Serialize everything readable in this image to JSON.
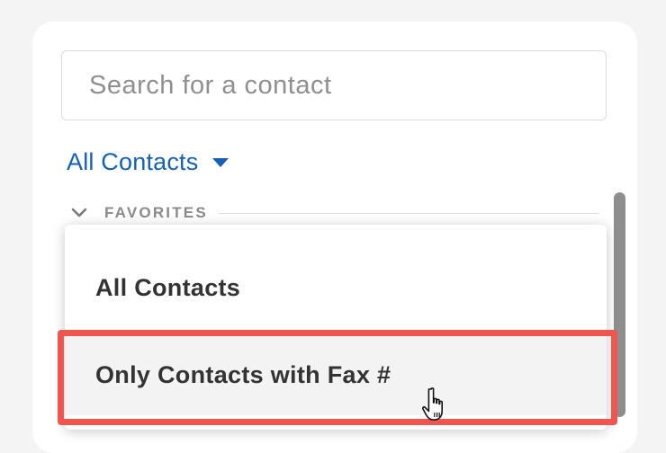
{
  "search": {
    "placeholder": "Search for a contact",
    "value": ""
  },
  "filter": {
    "selected_label": "All Contacts",
    "icon": "caret-down-icon",
    "color": "#1560b8"
  },
  "favorites": {
    "label": "FAVORITES",
    "icon": "chevron-down-icon"
  },
  "dropdown": {
    "options": [
      {
        "label": "All Contacts"
      },
      {
        "label": "Only Contacts with Fax #"
      }
    ],
    "hovered_index": 1
  },
  "annotation": {
    "highlight_color": "#f0564e"
  },
  "cursor": {
    "icon": "hand-pointer-icon"
  }
}
